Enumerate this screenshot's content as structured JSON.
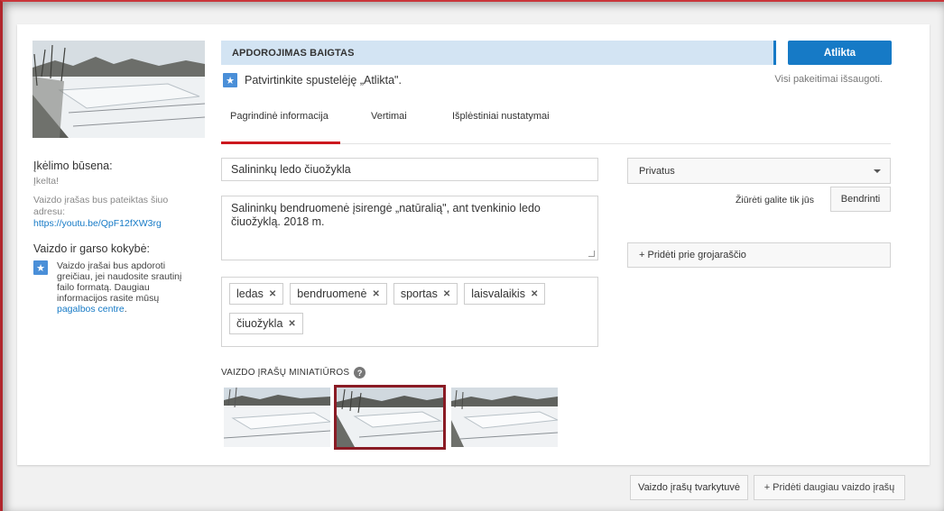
{
  "banner": {
    "status": "APDOROJIMAS BAIGTAS",
    "done_label": "Atlikta"
  },
  "confirm": {
    "text": "Patvirtinkite spustelėję „Atlikta\".",
    "saved": "Visi pakeitimai išsaugoti."
  },
  "tabs": [
    {
      "label": "Pagrindinė informacija"
    },
    {
      "label": "Vertimai"
    },
    {
      "label": "Išplėstiniai nustatymai"
    }
  ],
  "sidebar": {
    "upload_status_title": "Įkėlimo būsena:",
    "upload_status_value": "Įkelta!",
    "url_note": "Vaizdo įrašas bus pateiktas šiuo adresu:",
    "url": "https://youtu.be/QpF12fXW3rg",
    "quality_title": "Vaizdo ir garso kokybė:",
    "quality_text": "Vaizdo įrašai bus apdoroti greičiau, jei naudosite srautinį failo formatą. Daugiau informacijos rasite mūsų",
    "help_link": "pagalbos centre",
    "help_suffix": "."
  },
  "form": {
    "title": "Salininkų ledo čiuožykla",
    "description": "Salininkų bendruomenė įsirengė „natūralią\", ant tvenkinio ledo čiuožyklą. 2018 m.",
    "tags": [
      "ledas",
      "bendruomenė",
      "sportas",
      "laisvalaikis",
      "čiuožykla"
    ]
  },
  "thumbnails": {
    "label": "VAIZDO ĮRAŠŲ MINIATIŪROS",
    "help": "?",
    "selected_index": 1
  },
  "right": {
    "privacy": "Privatus",
    "visible_to": "Žiūrėti galite tik jūs",
    "share": "Bendrinti",
    "playlist": "+ Pridėti prie grojaraščio"
  },
  "footer": {
    "manager": "Vaizdo įrašų tvarkytuvė",
    "add_more": "+ Pridėti daugiau vaizdo įrašų"
  }
}
